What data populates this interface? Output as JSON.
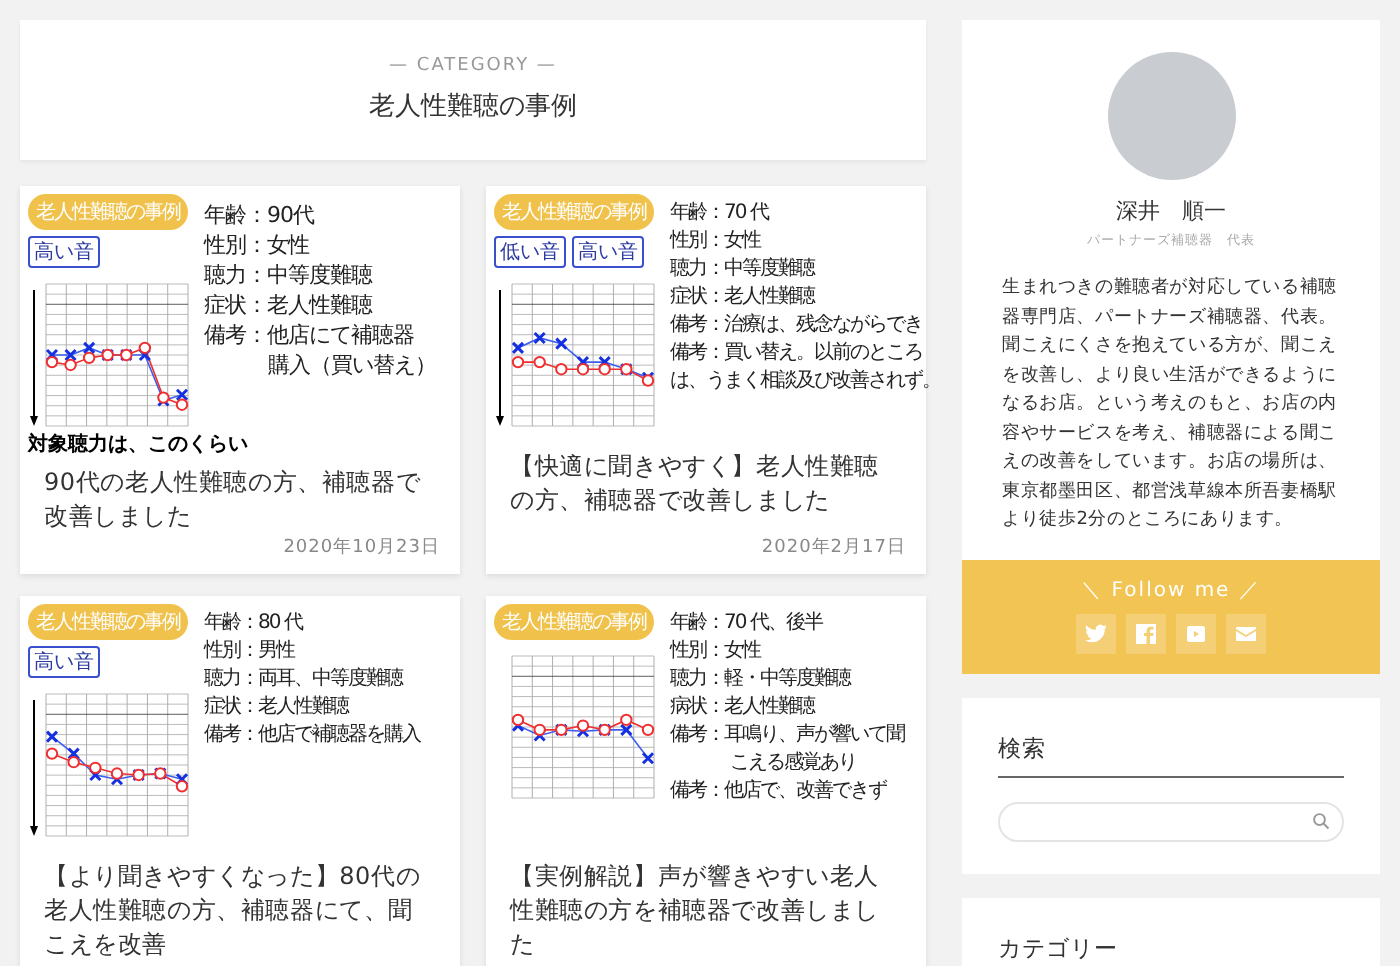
{
  "header": {
    "eyebrow": "— CATEGORY —",
    "title": "老人性難聴の事例"
  },
  "posts": [
    {
      "badge": "老人性難聴の事例",
      "tags": [
        "高い音"
      ],
      "profile": [
        {
          "kind": "line",
          "text": "年齢：90代"
        },
        {
          "kind": "line",
          "text": "性別：女性"
        },
        {
          "kind": "line",
          "text": "聴力：中等度難聴"
        },
        {
          "kind": "line",
          "text": "症状：老人性難聴"
        },
        {
          "kind": "line",
          "text": "備考：他店にて補聴器"
        },
        {
          "kind": "continuation",
          "text": "購入（買い替え）"
        }
      ],
      "note": "対象聴力は、このくらい",
      "title": "90代の老人性難聴の方、補聴器で改善しました",
      "date": "2020年10月23日"
    },
    {
      "badge": "老人性難聴の事例",
      "tags": [
        "低い音",
        "高い音"
      ],
      "profile": [
        {
          "kind": "line",
          "text": "年齢：70 代"
        },
        {
          "kind": "line",
          "text": "性別：女性"
        },
        {
          "kind": "line",
          "text": "聴力：中等度難聴"
        },
        {
          "kind": "line",
          "text": "症状：老人性難聴"
        },
        {
          "kind": "line",
          "text": "備考：治療は、残念ながらでき"
        },
        {
          "kind": "line",
          "text": "備考：買い替え。以前のところ"
        },
        {
          "kind": "line",
          "text": "は、うまく相談及び改善されず。"
        }
      ],
      "title": "【快適に聞きやすく】老人性難聴の方、補聴器で改善しました",
      "date": "2020年2月17日"
    },
    {
      "badge": "老人性難聴の事例",
      "tags": [
        "高い音"
      ],
      "profile": [
        {
          "kind": "line",
          "text": "年齢：80 代"
        },
        {
          "kind": "line",
          "text": "性別：男性"
        },
        {
          "kind": "line",
          "text": "聴力：両耳、中等度難聴"
        },
        {
          "kind": "line",
          "text": "症状：老人性難聴"
        },
        {
          "kind": "line",
          "text": "備考：他店で補聴器を購入"
        }
      ],
      "title": "【より聞きやすくなった】80代の老人性難聴の方、補聴器にて、聞こえを改善"
    },
    {
      "badge": "老人性難聴の事例",
      "profile": [
        {
          "kind": "line",
          "text": "年齢：70 代、後半"
        },
        {
          "kind": "line",
          "text": "性別：女性"
        },
        {
          "kind": "line",
          "text": "聴力：軽・中等度難聴"
        },
        {
          "kind": "line",
          "text": "病状：老人性難聴"
        },
        {
          "kind": "line",
          "text": "備考：耳鳴り、声が響いて聞"
        },
        {
          "kind": "continuation",
          "text": "こえる感覚あり"
        },
        {
          "kind": "line",
          "text": "備考：他店で、改善できず"
        }
      ],
      "title": "【実例解説】声が響きやすい老人性難聴の方を補聴器で改善しました"
    }
  ],
  "sidebar": {
    "profile": {
      "name": "深井　順一",
      "role": "パートナーズ補聴器　代表",
      "bio": "生まれつきの難聴者が対応している補聴器専門店、パートナーズ補聴器、代表。聞こえにくさを抱えている方が、聞こえを改善し、より良い生活ができるようになるお店。という考えのもと、お店の内容やサービスを考え、補聴器による聞こえの改善をしています。お店の場所は、東京都墨田区、都営浅草線本所吾妻橋駅より徒歩2分のところにあります。",
      "follow": {
        "label": "＼ Follow me ／",
        "links": [
          {
            "kind": "twitter"
          },
          {
            "kind": "facebook"
          },
          {
            "kind": "youtube"
          },
          {
            "kind": "mail"
          }
        ]
      }
    },
    "search": {
      "title": "検索"
    },
    "category": {
      "title": "カテゴリー"
    }
  }
}
